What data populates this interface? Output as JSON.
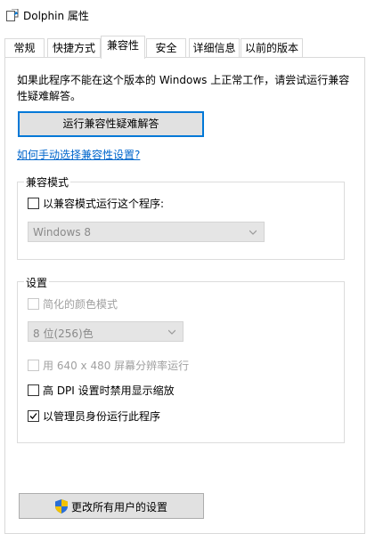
{
  "window": {
    "title": "Dolphin 属性"
  },
  "tabs": [
    {
      "label": "常规"
    },
    {
      "label": "快捷方式"
    },
    {
      "label": "兼容性"
    },
    {
      "label": "安全"
    },
    {
      "label": "详细信息"
    },
    {
      "label": "以前的版本"
    }
  ],
  "active_tab": "兼容性",
  "compat": {
    "description": "如果此程序不能在这个版本的 Windows 上正常工作，请尝试运行兼容性疑难解答。",
    "troubleshooter_button": "运行兼容性疑难解答",
    "manual_link": "如何手动选择兼容性设置?",
    "mode_group": {
      "title": "兼容模式",
      "checkbox_label": "以兼容模式运行这个程序:",
      "checked": false,
      "os_select": "Windows 8"
    },
    "settings_group": {
      "title": "设置",
      "reduced_color_label": "简化的颜色模式",
      "color_select": "8 位(256)色",
      "res640_label": "用 640 x 480 屏幕分辨率运行",
      "dpi_label": "高 DPI 设置时禁用显示缩放",
      "admin_label": "以管理员身份运行此程序",
      "admin_checked": true
    },
    "all_users_button": "更改所有用户的设置"
  },
  "colors": {
    "accent": "#0078d7",
    "link": "#0066cc",
    "disabled_text": "#a0a0a0"
  }
}
